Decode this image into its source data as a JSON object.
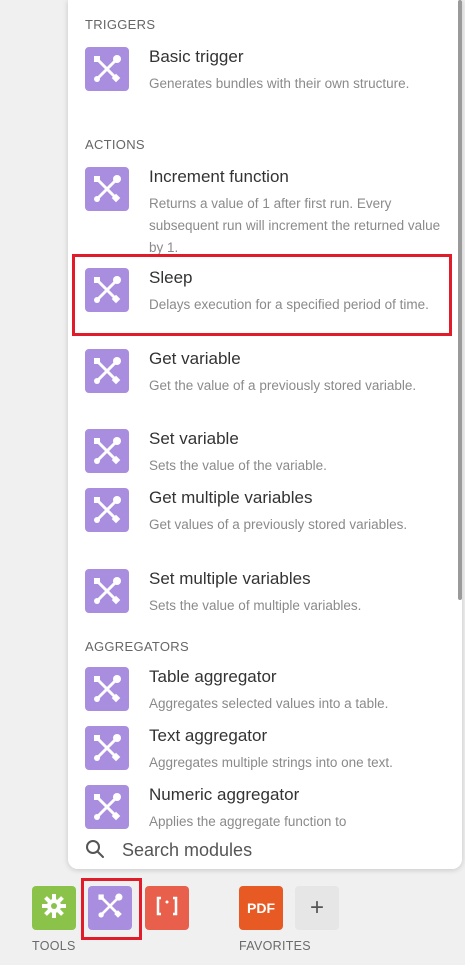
{
  "sections": [
    {
      "header": "TRIGGERS",
      "items": [
        {
          "title": "Basic trigger",
          "desc": "Generates bundles with their own structure."
        }
      ]
    },
    {
      "header": "ACTIONS",
      "items": [
        {
          "title": "Increment function",
          "desc": "Returns a value of 1 after first run. Every subsequent run will increment the returned value by 1."
        },
        {
          "title": "Sleep",
          "desc": "Delays execution for a specified period of time."
        },
        {
          "title": "Get variable",
          "desc": "Get the value of a previously stored variable."
        },
        {
          "title": "Set variable",
          "desc": "Sets the value of the variable."
        },
        {
          "title": "Get multiple variables",
          "desc": "Get values of a previously stored variables."
        },
        {
          "title": "Set multiple variables",
          "desc": "Sets the value of multiple variables."
        }
      ]
    },
    {
      "header": "AGGREGATORS",
      "items": [
        {
          "title": "Table aggregator",
          "desc": "Aggregates selected values into a table."
        },
        {
          "title": "Text aggregator",
          "desc": "Aggregates multiple strings into one text."
        },
        {
          "title": "Numeric aggregator",
          "desc": "Applies the aggregate function to"
        }
      ]
    }
  ],
  "search": {
    "placeholder": "Search modules"
  },
  "dock": {
    "tools_label": "TOOLS",
    "favorites_label": "FAVORITES",
    "pdf_label": "PDF",
    "add_label": "+",
    "colors": {
      "settings": "#8bc34a",
      "tools": "#a98ee0",
      "json": "#e8604c",
      "pdf": "#e85a24"
    }
  },
  "colors": {
    "module_icon": "#a98ee0",
    "highlight": "#e01b2a"
  }
}
